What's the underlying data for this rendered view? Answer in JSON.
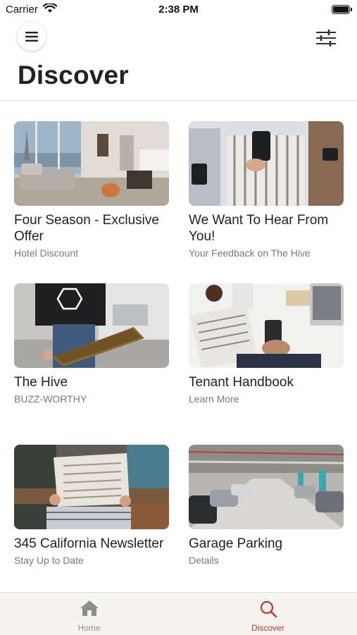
{
  "status_bar": {
    "carrier": "Carrier",
    "time": "2:38 PM"
  },
  "header": {
    "title": "Discover"
  },
  "cards": [
    {
      "title": "Four Season - Exclusive Offer",
      "subtitle": "Hotel Discount"
    },
    {
      "title": "We Want To Hear From You!",
      "subtitle": "Your Feedback on The Hive"
    },
    {
      "title": "The Hive",
      "subtitle": "BUZZ-WORTHY"
    },
    {
      "title": "Tenant Handbook",
      "subtitle": "Learn More"
    },
    {
      "title": "345 California Newsletter",
      "subtitle": "Stay Up to Date"
    },
    {
      "title": "Garage Parking",
      "subtitle": "Details"
    }
  ],
  "tab_bar": {
    "home_label": "Home",
    "discover_label": "Discover",
    "active": "discover",
    "active_color": "#c9302c",
    "inactive_color": "#8e8e8e"
  },
  "icons": {
    "menu": "hamburger-icon",
    "filter": "sliders-icon",
    "home": "home-icon",
    "discover": "search-icon"
  }
}
